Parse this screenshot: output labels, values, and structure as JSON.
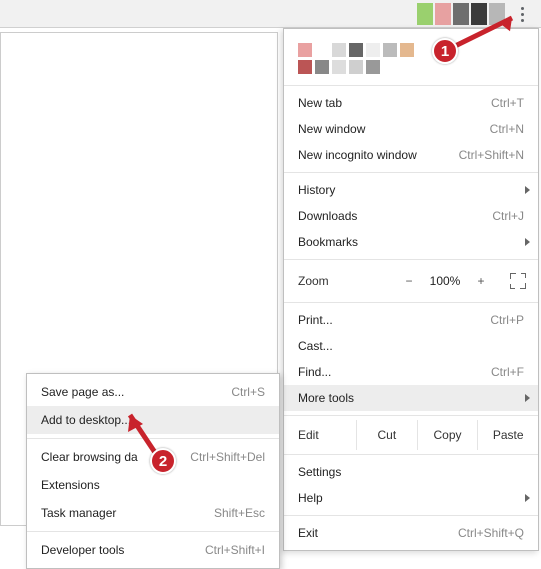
{
  "menu": {
    "new_tab": {
      "label": "New tab",
      "shortcut": "Ctrl+T"
    },
    "new_window": {
      "label": "New window",
      "shortcut": "Ctrl+N"
    },
    "new_incognito": {
      "label": "New incognito window",
      "shortcut": "Ctrl+Shift+N"
    },
    "history": {
      "label": "History"
    },
    "downloads": {
      "label": "Downloads",
      "shortcut": "Ctrl+J"
    },
    "bookmarks": {
      "label": "Bookmarks"
    },
    "zoom": {
      "label": "Zoom",
      "minus": "−",
      "pct": "100%",
      "plus": "+"
    },
    "print": {
      "label": "Print...",
      "shortcut": "Ctrl+P"
    },
    "cast": {
      "label": "Cast..."
    },
    "find": {
      "label": "Find...",
      "shortcut": "Ctrl+F"
    },
    "more_tools": {
      "label": "More tools"
    },
    "edit": {
      "label": "Edit",
      "cut": "Cut",
      "copy": "Copy",
      "paste": "Paste"
    },
    "settings": {
      "label": "Settings"
    },
    "help": {
      "label": "Help"
    },
    "exit": {
      "label": "Exit",
      "shortcut": "Ctrl+Shift+Q"
    }
  },
  "submenu": {
    "save_page": {
      "label": "Save page as...",
      "shortcut": "Ctrl+S"
    },
    "add_desktop": {
      "label": "Add to desktop..."
    },
    "clear_data": {
      "label": "Clear browsing da",
      "shortcut": "Ctrl+Shift+Del"
    },
    "extensions": {
      "label": "Extensions"
    },
    "task_manager": {
      "label": "Task manager",
      "shortcut": "Shift+Esc"
    },
    "dev_tools": {
      "label": "Developer tools",
      "shortcut": "Ctrl+Shift+I"
    }
  },
  "annotations": {
    "badge1": "1",
    "badge2": "2"
  }
}
